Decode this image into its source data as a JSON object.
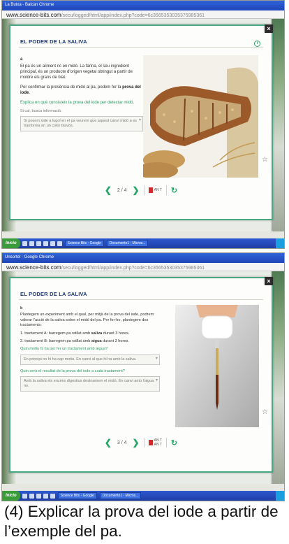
{
  "top": {
    "window_title": "La Butxa - Balcan Chrome",
    "url_host": "www.science-bits.com",
    "url_path": "/secu/logged/html/app/index.php?code=6c3565353035375985361",
    "title": "EL PODER DE LA SALIVA",
    "section": "a",
    "para1_a": "El pa és un aliment ric en midó. La farina, el seu ingredient principal, és un producte d'origen vegetal obtingut a partir de moldre els grans de blat.",
    "para2_a": "Per confirmar la presència de midó al pa, podem fer la ",
    "para2_b": "prova del iode",
    "question": "Explica en què consisteix la prova del iode per detectar midó.",
    "hint": "Si cal, busca informació.",
    "answer": "Si posem iode a lugol en el pa veurem que aquest canvi midó a es tranforma en un color blavós.",
    "page": "2 / 4",
    "eval_label": "AN T"
  },
  "bottom": {
    "window_title": "Unsortel - Google Chrome",
    "url_host": "www.science-bits.com",
    "url_path": "/secu/logged/html/app/index.php?code=6c3565353035375985361",
    "title": "EL PODER DE LA SALIVA",
    "section": "b",
    "para1": "Plantegem un experiment amb el qual, per mitjà de la prova del iode, podrem valorar l'acció de la saliva sobre el midó del pa. Per fer-ho, plantegem dos tractaments:",
    "t1_a": "1. tractament A: barregem pa ratllat amb ",
    "t1_b": "saliva",
    "t1_c": " durant 3 hores.",
    "t2_a": "2. tractament B: barregem pa ratllat amb ",
    "t2_b": "aigua",
    "t2_c": " durant 3 hores.",
    "q1": "Quin motiu hi ha per fer un tractament amb aigua?",
    "a1": "En principi no hi ha cap motiu. En canvi al que hi ha amb la saliva.",
    "q2": "Quin serà el resultat de la prova del iode a cada tractament?",
    "a2": "Amb la saliva els enzims digestius destrueixen el midó. En canvi amb l'aigua no.",
    "page": "3 / 4",
    "eval_label": "AN T\nAN T"
  },
  "taskbar": {
    "start": "Inicio",
    "items": [
      "Science Bits - Google",
      "Documento1 - Micros..."
    ]
  },
  "caption": "(4) Explicar la prova del iode a partir de l’exemple del pa."
}
